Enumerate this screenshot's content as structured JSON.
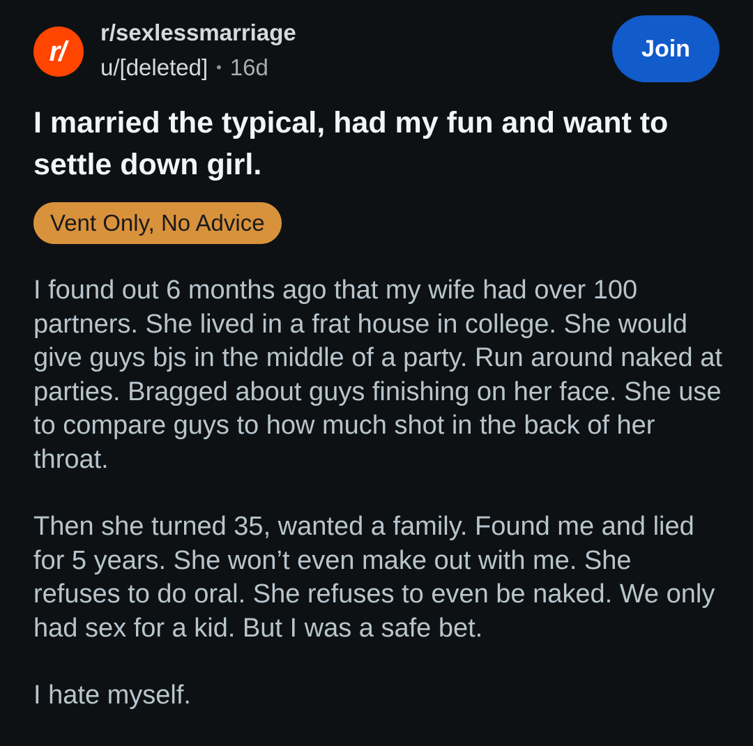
{
  "header": {
    "subreddit_icon_text": "r/",
    "subreddit": "r/sexlessmarriage",
    "author": "u/[deleted]",
    "separator": "•",
    "age": "16d",
    "join_label": "Join"
  },
  "post": {
    "title": "I married the typical, had my fun and want to settle down girl.",
    "flair": "Vent Only, No Advice",
    "paragraphs": [
      "I found out 6 months ago that my wife had over 100 partners. She lived in a frat house in college. She would give guys bjs in the middle of a party. Run around naked at parties. Bragged about guys finishing on her face. She use to compare guys to how much shot in the back of her throat.",
      "Then she turned 35, wanted a family. Found me and lied for 5 years. She won’t even make out with me. She refuses to do oral. She refuses to even be naked. We only had sex for a kid. But I was a safe bet.",
      "I hate myself."
    ]
  },
  "colors": {
    "background": "#0e1113",
    "subreddit_icon": "#ff4500",
    "join_button": "#115bca",
    "flair": "#d9923c",
    "body_text": "#b8c5cd"
  }
}
